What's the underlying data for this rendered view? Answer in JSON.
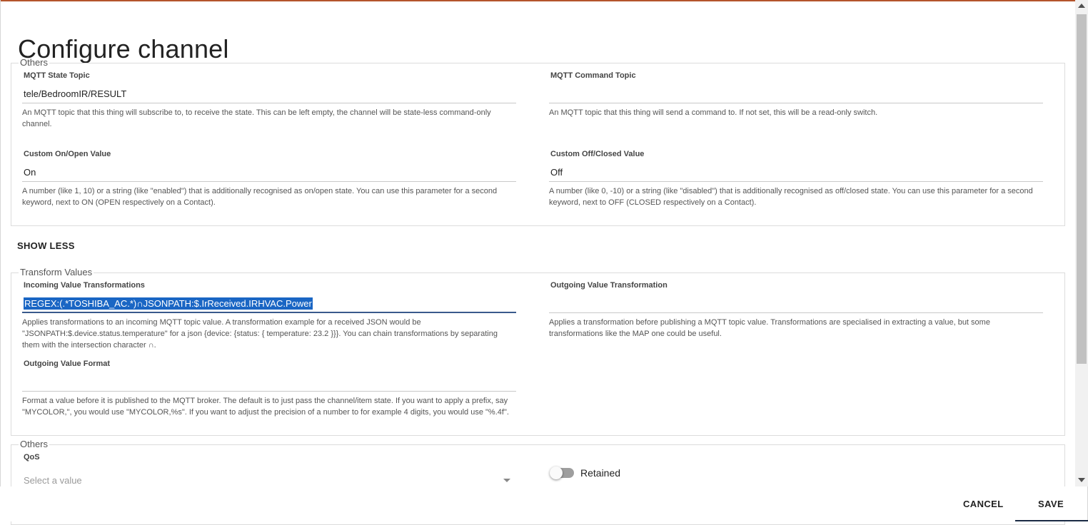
{
  "dialog": {
    "title": "Configure channel"
  },
  "groups": {
    "others_top": {
      "legend": "Others",
      "state_topic": {
        "label": "MQTT State Topic",
        "value": "tele/BedroomIR/RESULT",
        "hint": "An MQTT topic that this thing will subscribe to, to receive the state. This can be left empty, the channel will be state-less command-only channel."
      },
      "command_topic": {
        "label": "MQTT Command Topic",
        "value": "",
        "hint": "An MQTT topic that this thing will send a command to. If not set, this will be a read-only switch."
      },
      "on_value": {
        "label": "Custom On/Open Value",
        "value": "On",
        "hint": "A number (like 1, 10) or a string (like \"enabled\") that is additionally recognised as on/open state. You can use this parameter for a second keyword, next to ON (OPEN respectively on a Contact)."
      },
      "off_value": {
        "label": "Custom Off/Closed Value",
        "value": "Off",
        "hint": "A number (like 0, -10) or a string (like \"disabled\") that is additionally recognised as off/closed state. You can use this parameter for a second keyword, next to OFF (CLOSED respectively on a Contact)."
      }
    },
    "show_less": "SHOW LESS",
    "transform": {
      "legend": "Transform Values",
      "incoming": {
        "label": "Incoming Value Transformations",
        "value": "REGEX:(.*TOSHIBA_AC.*)∩JSONPATH:$.IrReceived.IRHVAC.Power",
        "hint": "Applies transformations to an incoming MQTT topic value. A transformation example for a received JSON would be \"JSONPATH:$.device.status.temperature\" for a json {device: {status: { temperature: 23.2 }}}. You can chain transformations by separating them with the intersection character ∩."
      },
      "outgoing": {
        "label": "Outgoing Value Transformation",
        "value": "",
        "hint": "Applies a transformation before publishing a MQTT topic value. Transformations are specialised in extracting a value, but some transformations like the MAP one could be useful."
      },
      "format": {
        "label": "Outgoing Value Format",
        "value": "",
        "hint": "Format a value before it is published to the MQTT broker. The default is to just pass the channel/item state. If you want to apply a prefix, say \"MYCOLOR,\", you would use \"MYCOLOR,%s\". If you want to adjust the precision of a number to for example 4 digits, you would use \"%.4f\"."
      }
    },
    "others_bottom": {
      "legend": "Others",
      "qos": {
        "label": "QoS",
        "placeholder": "Select a value"
      },
      "retained": {
        "label": "Retained",
        "enabled": false
      }
    }
  },
  "footer": {
    "cancel": "CANCEL",
    "save": "SAVE"
  },
  "colors": {
    "accent_top": "#b4542b",
    "selection": "#1a66c4",
    "focus_underline": "#3a5a8c"
  }
}
